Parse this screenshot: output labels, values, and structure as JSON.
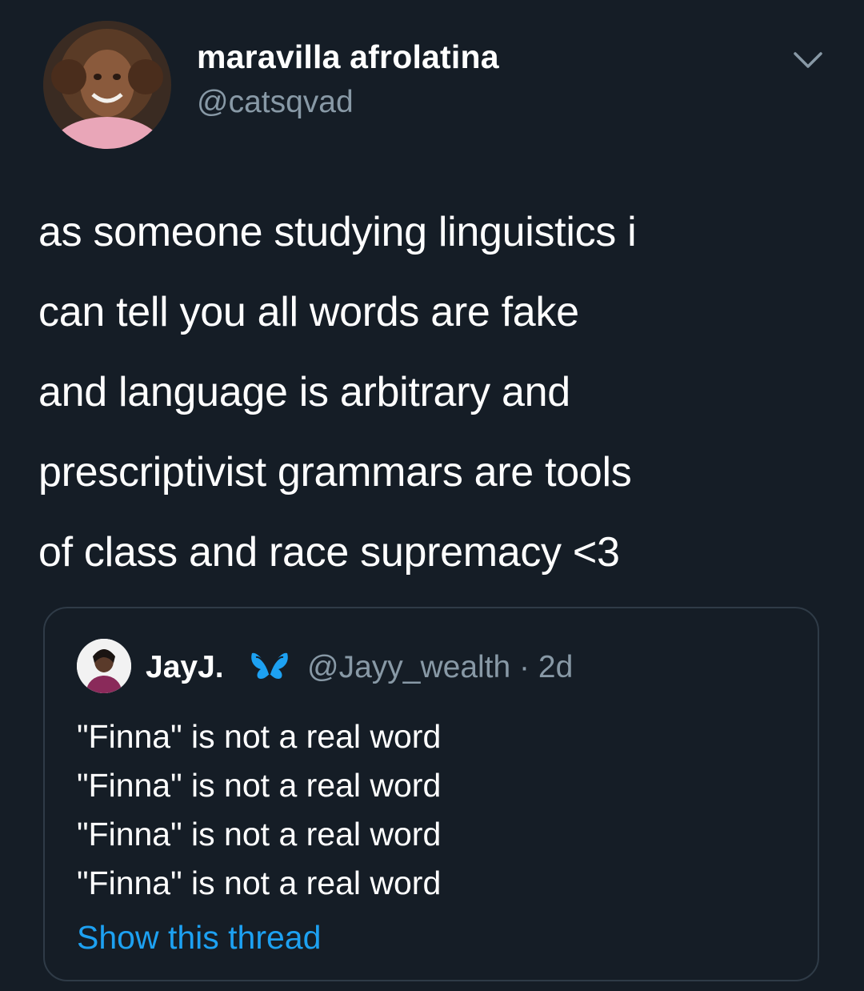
{
  "tweet": {
    "author": {
      "display_name": "maravilla afrolatina",
      "handle": "@catsqvad"
    },
    "menu_icon": "chevron-down-icon",
    "text_lines": [
      "as someone studying linguistics i",
      "can tell you all words are fake",
      "and language is arbitrary and",
      "prescriptivist grammars are tools",
      "of class and race supremacy <3"
    ]
  },
  "quoted_tweet": {
    "author": {
      "display_name": "JayJ.",
      "badge_icon": "butterfly-icon",
      "handle": "@Jayy_wealth",
      "time": "2d"
    },
    "lines": [
      "\"Finna\" is not a real word",
      "\"Finna\" is not a real word",
      "\"Finna\" is not a real word",
      "\"Finna\" is not a real word"
    ],
    "show_thread_label": "Show this thread"
  },
  "colors": {
    "background": "#151d26",
    "text_primary": "#ffffff",
    "text_secondary": "#8899a6",
    "link": "#1da1f2",
    "card_border": "#2f3b47",
    "badge": "#1da1f2"
  }
}
